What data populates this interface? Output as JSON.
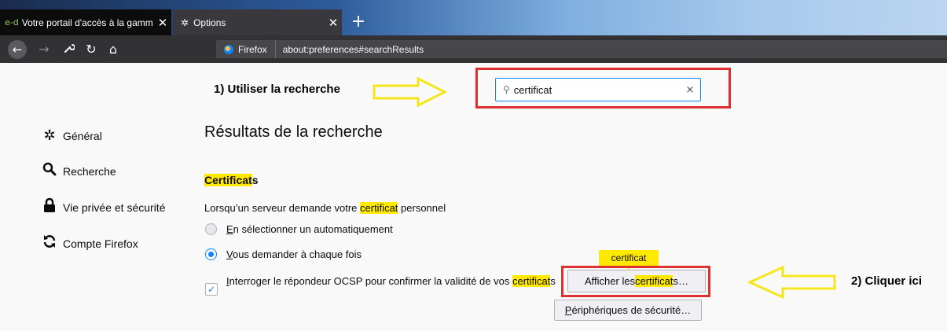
{
  "tabs": [
    {
      "label": "Votre portail d'accès à la gamm",
      "favicon_text": "e-d",
      "close": "✕"
    },
    {
      "label": "Options",
      "close": "✕"
    }
  ],
  "new_tab_label": "+",
  "toolbar": {
    "back": "←",
    "forward": "→",
    "tools": "🔧",
    "reload": "↻",
    "home": "⌂"
  },
  "urlbar": {
    "brand": "Firefox",
    "url": "about:preferences#searchResults"
  },
  "search": {
    "value": "certificat",
    "clear": "×"
  },
  "annotations": {
    "step1": "1) Utiliser la recherche",
    "step2": "2) Cliquer ici"
  },
  "sidebar": {
    "items": [
      {
        "label": "Général",
        "icon": "gear-icon"
      },
      {
        "label": "Recherche",
        "icon": "search-icon"
      },
      {
        "label": "Vie privée et sécurité",
        "icon": "lock-icon"
      },
      {
        "label": "Compte Firefox",
        "icon": "sync-icon"
      }
    ]
  },
  "main": {
    "title": "Résultats de la recherche",
    "section": {
      "title_hl": "Certificat",
      "title_rest": "s"
    },
    "desc": {
      "before": "Lorsqu’un serveur demande votre ",
      "hl": "certificat",
      "after": " personnel"
    },
    "radio_auto": {
      "u": "E",
      "rest": "n sélectionner un automatiquement",
      "checked": false
    },
    "radio_ask": {
      "u": "V",
      "rest": "ous demander à chaque fois",
      "checked": true
    },
    "ocsp": {
      "u": "I",
      "rest": "nterroger le répondeur OCSP pour confirmer la validité de vos ",
      "hl": "certificat",
      "after": "s",
      "checked": true
    },
    "tooltip": "certificat",
    "view_certs": {
      "before": "Afficher les ",
      "hl": "certificat",
      "after": "s…"
    },
    "security_devices": {
      "u": "P",
      "rest": "ériphériques de sécurité…"
    }
  },
  "colors": {
    "highlight": "#ffe900",
    "annotation_box": "#e02f30",
    "arrow": "#f5e61a",
    "accent": "#0a84ff"
  }
}
